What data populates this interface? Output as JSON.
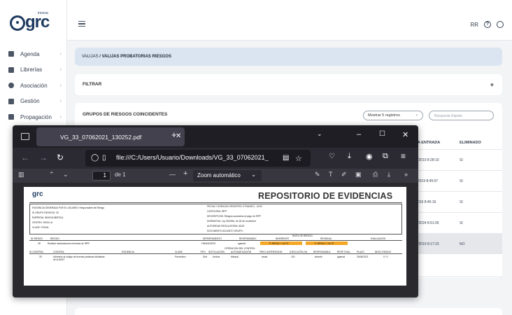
{
  "brand": {
    "name": "grc",
    "tag": "innova"
  },
  "sidebar": {
    "items": [
      {
        "label": "Agenda",
        "icon": "calendar-icon"
      },
      {
        "label": "Librerías",
        "icon": "library-icon"
      },
      {
        "label": "Asociación",
        "icon": "link-icon"
      },
      {
        "label": "Gestión",
        "icon": "list-icon"
      },
      {
        "label": "Propagación",
        "icon": "copy-icon"
      }
    ]
  },
  "topbar": {
    "user": "RR",
    "help": "?"
  },
  "breadcrumb": {
    "parent": "VALIJAS",
    "sep": " / ",
    "current": "VALIJAS PROBATORIAS RIESGOS"
  },
  "filter": {
    "title": "FILTRAR",
    "toggle": "+"
  },
  "groups": {
    "title": "GRUPOS DE RIESGOS COINCIDENTES",
    "page_size": "Mostrar 5 registros",
    "search_placeholder": "Búsqueda Rápida",
    "columns": {
      "entrada": "A ENTRADA",
      "eliminado": "ELIMINADO"
    },
    "rows": [
      {
        "entrada": "/2019 8:28:19",
        "eliminado": "SI"
      },
      {
        "entrada": "2019 8:45:07",
        "eliminado": "SI"
      },
      {
        "entrada": "019 8:45:16",
        "eliminado": "SI"
      },
      {
        "entrada": "/2024 8:51:05",
        "eliminado": "SI"
      },
      {
        "entrada": "/2019 8:17:23",
        "eliminado": "NO"
      }
    ]
  },
  "browser": {
    "tab_title": "VG_33_07062021_130252.pdf",
    "url": "file:///C:/Users/Usuario/Downloads/VG_33_07062021_",
    "page_current": "1",
    "page_total": "de 1",
    "zoom": "Zoom automático"
  },
  "pdf": {
    "logo": "grc",
    "title": "REPOSITORIO DE EVIDENCIAS",
    "left_fields": [
      "EVIDENCIA GENERADA POR EL USUARIO: Responsable del Riesgo",
      "ID GRUPO RIESGOS: 33",
      "EMPRESA: INNOVA IBERICA",
      "CENTRO: SEVILLA",
      "CLASE: FISCAL"
    ],
    "right_fields": [
      "FECHA Y HORA DEL REGISTRO: 07/06/2021 , 13:02",
      "CATEGORIA: IRPF",
      "DESCRIPCION: Riesgos asociados al pago de IRPF",
      "NORMATIVA: Ley 35/2006, de 28 de noviembre",
      "AUTORIDAD REGULATORIA: AEAT",
      "DOCUMENTO ADJUNTO GRUPO:"
    ],
    "risk_header": [
      "ID RIESGO",
      "RIESGO",
      "DEPARTAMENTO",
      "RESPONSABLE",
      "NIVEL DE RIESGO",
      "INHERENTE",
      "RESIDUAL",
      "EVALUACION"
    ],
    "risk_row": [
      "28",
      "Realizar declaraciones erróneas de IRPF",
      "FINANCIERO",
      "sgarrad",
      "P. MEDIA / I. ALTO",
      "P. MEDIA / I. ALTO"
    ],
    "control_group": "OPERACION DEL CONTROL",
    "control_header": [
      "ID CONTROL",
      "CONTROL",
      "EVIDENCIA",
      "CLASE",
      "TIPO",
      "INTITULACIÓN",
      "AUTOMATIZACIÓN",
      "FREC.SUPERVISION",
      "EJECUCIÓN (%)",
      "RESPONSABLE",
      "RESP. EVAL.",
      "PLAZO",
      "NIVEL RIESGO"
    ],
    "control_row": [
      "33",
      "Adhesión al código de buenas prácticas tributarias de la AEAT",
      "Preventivo",
      "Soft",
      "Ambos",
      "Manual",
      "anual",
      "100",
      "sbonde",
      "sgarrad",
      "30/06/2021",
      "0 / 0"
    ]
  }
}
